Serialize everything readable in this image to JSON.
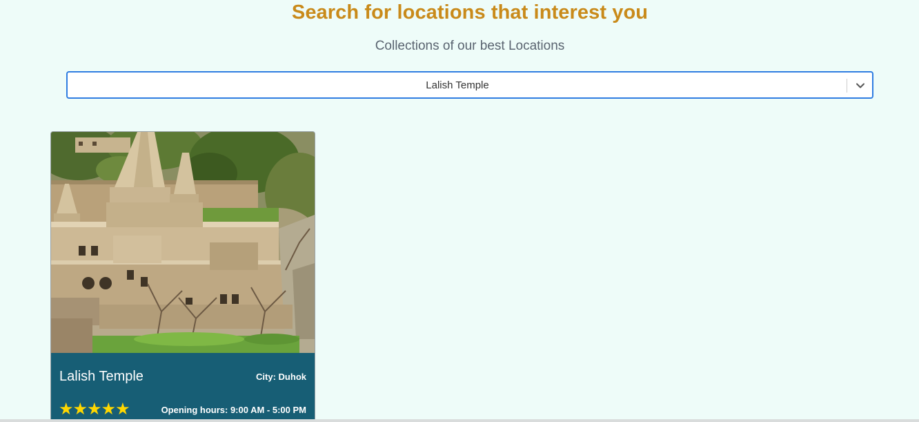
{
  "header": {
    "title": "Search for locations that interest you",
    "subtitle": "Collections of our best Locations"
  },
  "search": {
    "selected_value": "Lalish Temple",
    "chevron_icon": "chevron-down-icon"
  },
  "colors": {
    "title": "#c98a1a",
    "background": "#eefcf9",
    "card_footer": "#175e75",
    "star": "#ffd700",
    "select_border": "#2f7de1"
  },
  "cards": [
    {
      "name": "Lalish Temple",
      "city": "City: Duhok",
      "rating": 5,
      "rating_max": 5,
      "stars_text": "★★★★★",
      "hours": "Opening hours: 9:00 AM - 5:00 PM",
      "image_icon": "temple-photo"
    }
  ]
}
